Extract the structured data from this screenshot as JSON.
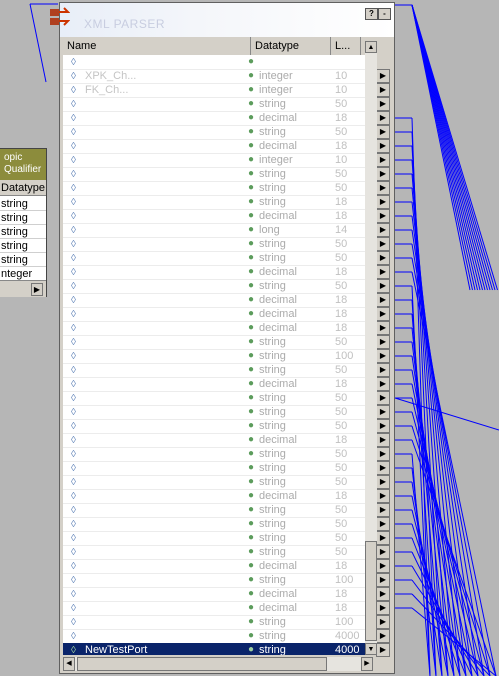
{
  "window": {
    "title": "XML PARSER",
    "help_btn": "?",
    "min_btn": "-"
  },
  "columns": {
    "name": "Name",
    "datatype": "Datatype",
    "length": "L..."
  },
  "rows": [
    {
      "name": "",
      "datatype": "",
      "prec": ""
    },
    {
      "name": "XPK_Ch...",
      "datatype": "integer",
      "prec": "10"
    },
    {
      "name": "FK_Ch...",
      "datatype": "integer",
      "prec": "10"
    },
    {
      "name": "",
      "datatype": "string",
      "prec": "50"
    },
    {
      "name": "",
      "datatype": "decimal",
      "prec": "18"
    },
    {
      "name": "",
      "datatype": "string",
      "prec": "50"
    },
    {
      "name": "",
      "datatype": "decimal",
      "prec": "18"
    },
    {
      "name": "",
      "datatype": "integer",
      "prec": "10"
    },
    {
      "name": "",
      "datatype": "string",
      "prec": "50"
    },
    {
      "name": "",
      "datatype": "string",
      "prec": "50"
    },
    {
      "name": "",
      "datatype": "string",
      "prec": "18"
    },
    {
      "name": "",
      "datatype": "decimal",
      "prec": "18"
    },
    {
      "name": "",
      "datatype": "long",
      "prec": "14"
    },
    {
      "name": "",
      "datatype": "string",
      "prec": "50"
    },
    {
      "name": "",
      "datatype": "string",
      "prec": "50"
    },
    {
      "name": "",
      "datatype": "decimal",
      "prec": "18"
    },
    {
      "name": "",
      "datatype": "string",
      "prec": "50"
    },
    {
      "name": "",
      "datatype": "decimal",
      "prec": "18"
    },
    {
      "name": "",
      "datatype": "decimal",
      "prec": "18"
    },
    {
      "name": "",
      "datatype": "decimal",
      "prec": "18"
    },
    {
      "name": "",
      "datatype": "string",
      "prec": "50"
    },
    {
      "name": "",
      "datatype": "string",
      "prec": "100"
    },
    {
      "name": "",
      "datatype": "string",
      "prec": "50"
    },
    {
      "name": "",
      "datatype": "decimal",
      "prec": "18"
    },
    {
      "name": "",
      "datatype": "string",
      "prec": "50"
    },
    {
      "name": "",
      "datatype": "string",
      "prec": "50"
    },
    {
      "name": "",
      "datatype": "string",
      "prec": "50"
    },
    {
      "name": "",
      "datatype": "decimal",
      "prec": "18"
    },
    {
      "name": "",
      "datatype": "string",
      "prec": "50"
    },
    {
      "name": "",
      "datatype": "string",
      "prec": "50"
    },
    {
      "name": "",
      "datatype": "string",
      "prec": "50"
    },
    {
      "name": "",
      "datatype": "decimal",
      "prec": "18"
    },
    {
      "name": "",
      "datatype": "string",
      "prec": "50"
    },
    {
      "name": "",
      "datatype": "string",
      "prec": "50"
    },
    {
      "name": "",
      "datatype": "string",
      "prec": "50"
    },
    {
      "name": "",
      "datatype": "string",
      "prec": "50"
    },
    {
      "name": "",
      "datatype": "decimal",
      "prec": "18"
    },
    {
      "name": "",
      "datatype": "string",
      "prec": "100"
    },
    {
      "name": "",
      "datatype": "decimal",
      "prec": "18"
    },
    {
      "name": "",
      "datatype": "decimal",
      "prec": "18"
    },
    {
      "name": "",
      "datatype": "string",
      "prec": "100"
    },
    {
      "name": "",
      "datatype": "string",
      "prec": "4000"
    }
  ],
  "selected_row": {
    "name": "NewTestPort",
    "datatype": "string",
    "prec": "4000"
  },
  "left_panel": {
    "title_line1": "opic",
    "title_line2": "Qualifier",
    "col_header": "Datatype",
    "rows": [
      "string",
      "string",
      "string",
      "string",
      "string",
      "nteger"
    ]
  },
  "colors": {
    "link_lines": "#0000ff",
    "selection": "#0a246a",
    "group_header": "#8c8c3c"
  }
}
